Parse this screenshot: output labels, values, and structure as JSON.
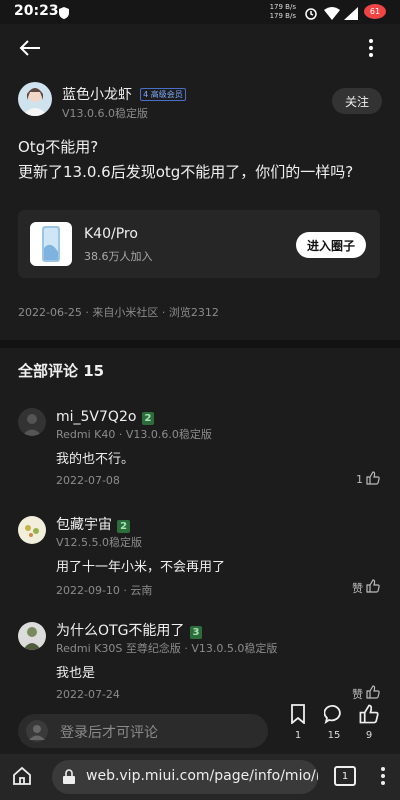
{
  "status_bar": {
    "time": "20:23",
    "speed_up": "179 B/s",
    "speed_down": "179 B/s",
    "battery": "61"
  },
  "header": {
    "back_icon": "back-arrow-icon",
    "more_icon": "more-vertical-icon"
  },
  "author": {
    "name": "蓝色小龙虾",
    "badge": "4 高级会员",
    "version": "V13.0.6.0稳定版",
    "follow_label": "关注"
  },
  "post": {
    "title": "Otg不能用?",
    "body": "更新了13.0.6后发现otg不能用了，你们的一样吗?",
    "circle": {
      "name": "K40/Pro",
      "members": "38.6万人加入",
      "join_label": "进入圈子"
    },
    "meta": "2022-06-25 · 来自小米社区 · 浏览2312"
  },
  "comments_section": {
    "title": "全部评论 15",
    "items": [
      {
        "name": "mi_5V7Q2o",
        "level": "2",
        "device": "Redmi K40 · V13.0.6.0稳定版",
        "text": "我的也不行。",
        "date": "2022-07-08",
        "likes": "1"
      },
      {
        "name": "包藏宇宙",
        "level": "2",
        "device": "V12.5.5.0稳定版",
        "text": "用了十一年小米，不会再用了",
        "date": "2022-09-10 · 云南",
        "likes": "赞"
      },
      {
        "name": "为什么OTG不能用了",
        "level": "3",
        "device": "Redmi K30S 至尊纪念版 · V13.0.5.0稳定版",
        "text": "我也是",
        "date": "2022-07-24",
        "likes": "赞"
      }
    ]
  },
  "bottom_bar": {
    "placeholder": "登录后才可评论",
    "bookmark_count": "1",
    "comment_count": "15",
    "like_count": "9"
  },
  "browser": {
    "url": "web.vip.miui.com/page/info/mio/mi",
    "tab_count": "1"
  },
  "colors": {
    "background": "#1c1c1c",
    "level_badge": "#2c6e3b",
    "card": "#262626"
  }
}
